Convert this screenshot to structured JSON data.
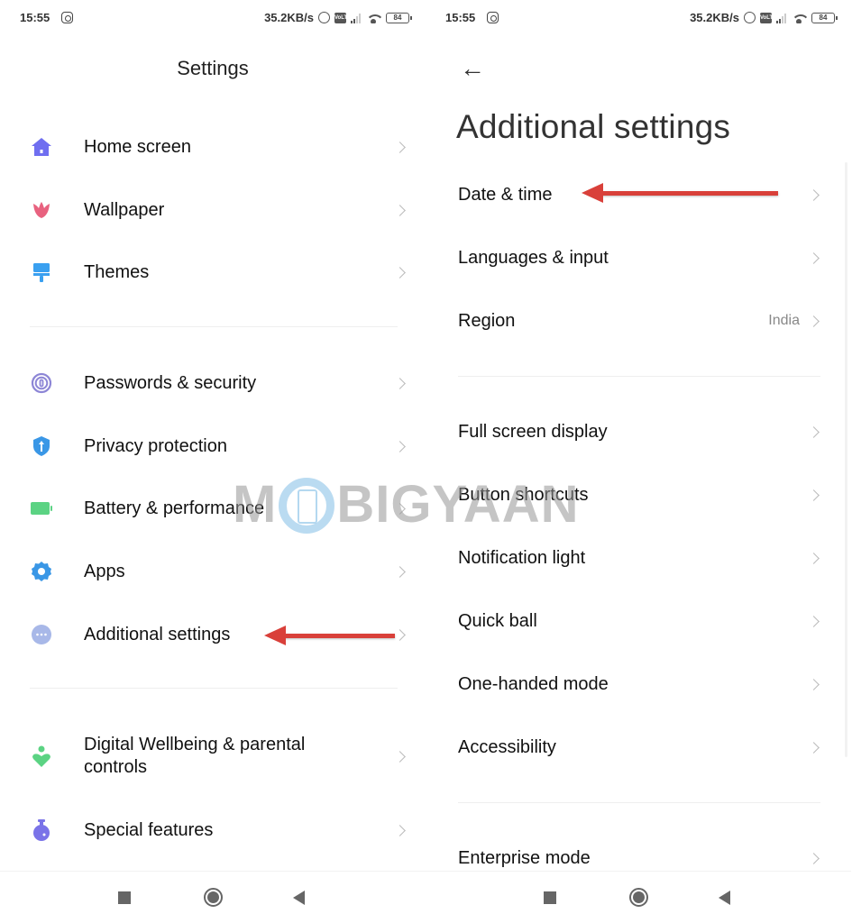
{
  "status_bar": {
    "time": "15:55",
    "speed": "35.2KB/s",
    "battery": "84",
    "icons": [
      "instagram-icon",
      "alarm-icon",
      "volte-icon",
      "signal-icon",
      "wifi-icon",
      "battery-icon"
    ]
  },
  "left_screen": {
    "title": "Settings",
    "groups": [
      [
        {
          "label": "Home screen",
          "icon": "home-icon",
          "color": "#6f6ef0"
        },
        {
          "label": "Wallpaper",
          "icon": "tulip-icon",
          "color": "#e8627f"
        },
        {
          "label": "Themes",
          "icon": "paintbrush-icon",
          "color": "#3aa0f0"
        }
      ],
      [
        {
          "label": "Passwords & security",
          "icon": "fingerprint-icon",
          "color": "#8d86d6"
        },
        {
          "label": "Privacy protection",
          "icon": "shield-icon",
          "color": "#3a97e6"
        },
        {
          "label": "Battery & performance",
          "icon": "battery-icon",
          "color": "#5bd383"
        },
        {
          "label": "Apps",
          "icon": "gear-icon",
          "color": "#3a97e6"
        },
        {
          "label": "Additional settings",
          "icon": "more-dots-icon",
          "color": "#a8b8e8"
        }
      ],
      [
        {
          "label": "Digital Wellbeing & parental controls",
          "icon": "wellbeing-heart-icon",
          "color": "#5bd383"
        },
        {
          "label": "Special features",
          "icon": "flask-icon",
          "color": "#7a73e8"
        }
      ]
    ]
  },
  "right_screen": {
    "back_icon": "back-arrow-icon",
    "title": "Additional settings",
    "groups": [
      [
        {
          "label": "Date & time"
        },
        {
          "label": "Languages & input"
        },
        {
          "label": "Region",
          "value": "India"
        }
      ],
      [
        {
          "label": "Full screen display"
        },
        {
          "label": "Button shortcuts"
        },
        {
          "label": "Notification light"
        },
        {
          "label": "Quick ball"
        },
        {
          "label": "One-handed mode"
        },
        {
          "label": "Accessibility"
        }
      ],
      [
        {
          "label": "Enterprise mode"
        }
      ]
    ]
  },
  "navbar": {
    "buttons": [
      "recents-square-icon",
      "home-circle-icon",
      "back-triangle-icon"
    ]
  },
  "annotations": {
    "arrow_color": "#d9403a",
    "watermark_text_left": "M",
    "watermark_text_right": "BIGYAAN"
  }
}
